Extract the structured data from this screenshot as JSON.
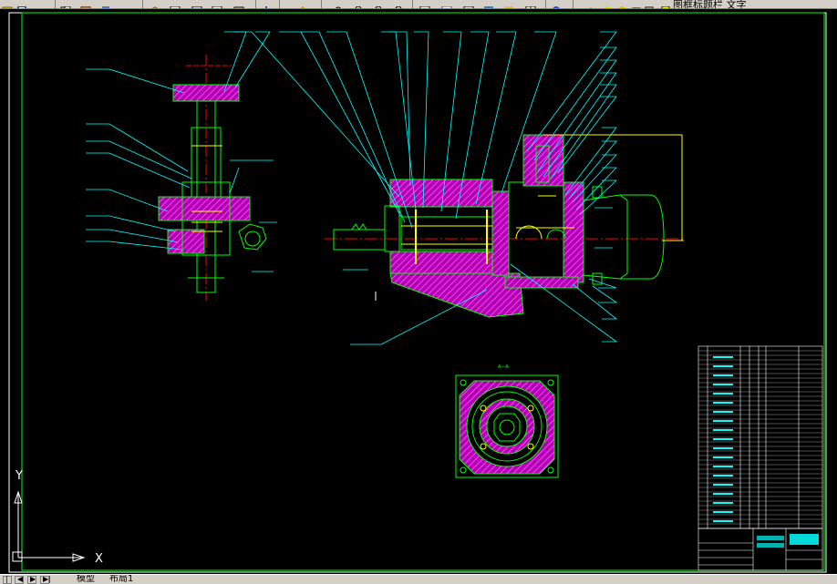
{
  "toolbar": {
    "icons": [
      "open-icon",
      "save-icon",
      "cut-icon",
      "copy-icon",
      "paste-icon",
      "match-properties-icon",
      "undo-icon",
      "redo-icon",
      "pan-icon",
      "zoom-realtime-icon",
      "zoom-window-icon",
      "zoom-previous-icon",
      "properties-icon",
      "design-center-icon",
      "tool-palettes-icon",
      "sheet-set-icon",
      "markup-icon",
      "calculator-icon",
      "layer-icon",
      "layer-state-icon",
      "layer-freeze-icon"
    ],
    "layer_text": "图框标题栏  文字"
  },
  "ucs": {
    "y_label": "Y",
    "x_label": "X"
  },
  "layout_tabs": {
    "model": "模型",
    "layout1": "布局1"
  },
  "nav_buttons": [
    "first-tab-button",
    "prev-tab-button",
    "next-tab-button",
    "last-tab-button"
  ],
  "colors": {
    "background": "#000000",
    "outline": "#00ff00",
    "hatch": "#ff00ff",
    "leader": "#00ffff",
    "centerline": "#ff0000",
    "dimension": "#ffff00",
    "border": "#ffffff"
  },
  "section_label": "A—A"
}
